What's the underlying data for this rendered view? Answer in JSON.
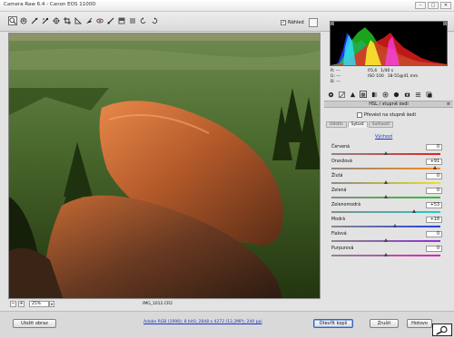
{
  "window": {
    "title": "Camera Raw 6.4  -  Canon EOS 1100D"
  },
  "toolbar": {
    "tools": [
      "zoom-icon",
      "hand-icon",
      "white-balance-icon",
      "color-sampler-icon",
      "target-adjust-icon",
      "crop-icon",
      "straighten-icon",
      "spot-removal-icon",
      "red-eye-icon",
      "adjustment-brush-icon",
      "graduated-filter-icon",
      "preferences-icon",
      "rotate-left-icon",
      "rotate-right-icon"
    ],
    "preview_label": "Náhled",
    "preview_checked": "✓"
  },
  "histogram": {
    "rgb_labels": [
      "R:  ---",
      "G:  ---",
      "B:  ---"
    ],
    "exif": [
      [
        "f/5,6",
        "1/40 s"
      ],
      [
        "ISO 100",
        "18-55@41 mm"
      ]
    ]
  },
  "panel": {
    "title": "HSL / stupně šedi",
    "convert_label": "Převést na stupně šedi",
    "subtabs": [
      "Odstín",
      "Sytost",
      "Svítivost"
    ],
    "active_subtab": "Sytost",
    "default_link": "Výchozí",
    "sliders": [
      {
        "label": "Červená",
        "value": "0",
        "level": 0
      },
      {
        "label": "Oranžová",
        "value": "+91",
        "level": 91
      },
      {
        "label": "Žlutá",
        "value": "0",
        "level": 0
      },
      {
        "label": "Zelená",
        "value": "0",
        "level": 0
      },
      {
        "label": "Zelenomodrá",
        "value": "+53",
        "level": 53
      },
      {
        "label": "Modrá",
        "value": "+18",
        "level": 18
      },
      {
        "label": "Fialová",
        "value": "0",
        "level": 0
      },
      {
        "label": "Purpurová",
        "value": "0",
        "level": 0
      }
    ]
  },
  "bottombar": {
    "zoom": "25%",
    "filename": "IMG_1012.CR2"
  },
  "footer": {
    "save_label": "Uložit obraz",
    "workflow_text": "Adobe RGB (1998); 8 bitů; 2848 x 4272 (12,2MP); 240 ppi",
    "open_label": "Otevřít kopii",
    "cancel_label": "Zrušit",
    "done_label": "Hotovo"
  },
  "colors": {
    "accent": "#3b63b8",
    "link": "#1a38c0"
  }
}
